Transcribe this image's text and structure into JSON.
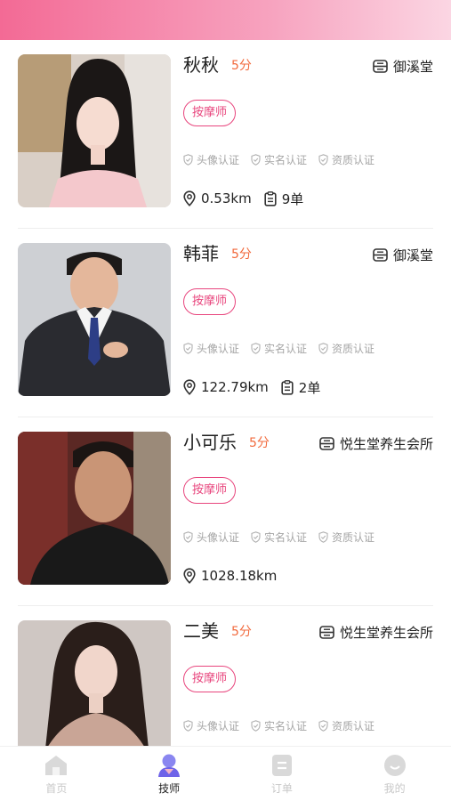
{
  "tabbar": {
    "home": "首页",
    "tech": "技师",
    "orders": "订单",
    "mine": "我的"
  },
  "certs": {
    "avatar": "头像认证",
    "realname": "实名认证",
    "qualification": "资质认证"
  },
  "technicians": [
    {
      "name": "秋秋",
      "score": "5分",
      "shop": "御溪堂",
      "role": "按摩师",
      "distance": "0.53km",
      "orders": "9单"
    },
    {
      "name": "韩菲",
      "score": "5分",
      "shop": "御溪堂",
      "role": "按摩师",
      "distance": "122.79km",
      "orders": "2单"
    },
    {
      "name": "小可乐",
      "score": "5分",
      "shop": "悦生堂养生会所",
      "role": "按摩师",
      "distance": "1028.18km"
    },
    {
      "name": "二美",
      "score": "5分",
      "shop": "悦生堂养生会所",
      "role": "按摩师"
    }
  ],
  "colors": {
    "accent": "#e8457d",
    "score": "#f26a3d",
    "header_start": "#f36a95",
    "header_end": "#fbd6e3"
  }
}
